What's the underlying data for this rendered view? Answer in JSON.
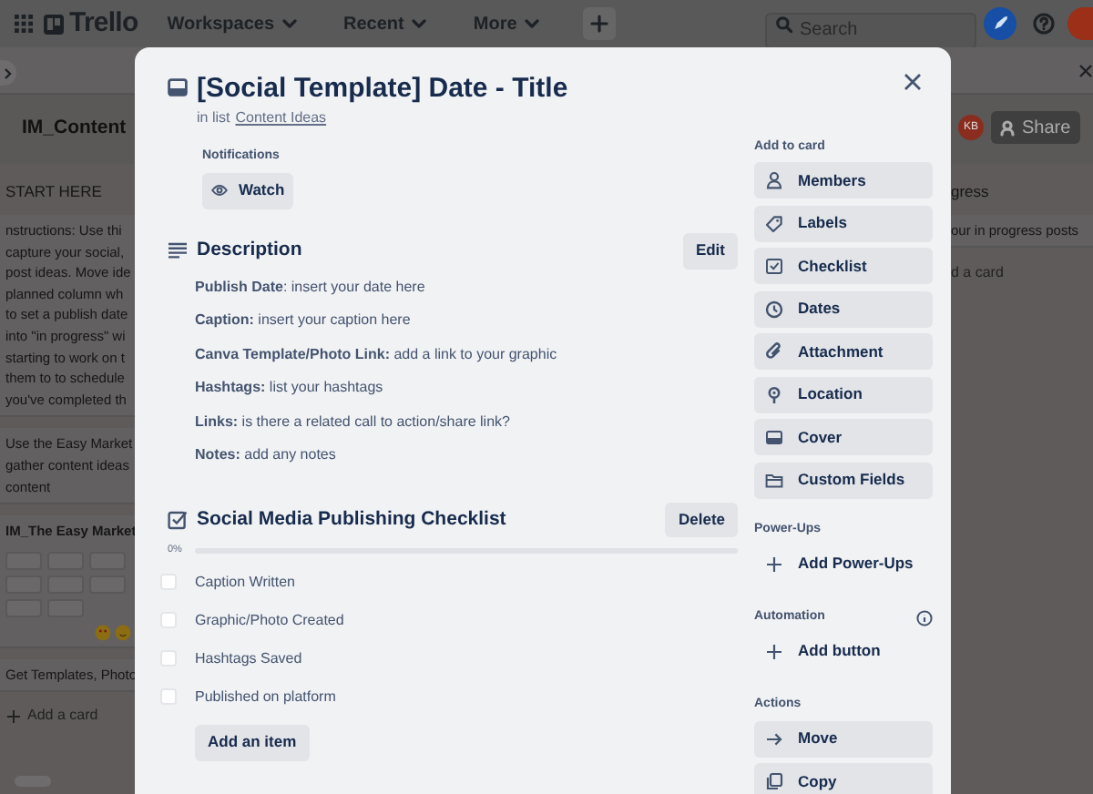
{
  "top_nav": {
    "logo": "Trello",
    "menus": [
      {
        "label": "Workspaces"
      },
      {
        "label": "Recent"
      },
      {
        "label": "More"
      }
    ],
    "search": {
      "placeholder": "Search"
    }
  },
  "board": {
    "title": "IM_Content",
    "avatar": "KB",
    "share": "Share",
    "left_list": {
      "title": "START HERE",
      "cards": [
        {
          "kind": "text",
          "lines": [
            "nstructions: Use thi",
            "capture your social,",
            "post ideas. Move ide",
            "planned column wh",
            "to set a publish date",
            "into \"in progress\" wi",
            "starting to work on t",
            "them to to schedule",
            "you've completed th"
          ]
        },
        {
          "kind": "text",
          "lines": [
            "Use the Easy Market",
            "gather content ideas",
            "content"
          ]
        },
        {
          "kind": "tiles",
          "lines": [
            "IM_The Easy Market"
          ]
        },
        {
          "kind": "text",
          "lines": [
            "Get Templates, Photo"
          ]
        }
      ],
      "add_card": "Add a card"
    },
    "right_list": {
      "title": "gress",
      "cards": [
        {
          "lines": [
            "our in progress posts"
          ]
        }
      ],
      "add_card": "d a card"
    }
  },
  "card_modal": {
    "title": "[Social Template] Date - Title",
    "list_prefix": "in list",
    "list_link": "Content Ideas",
    "notifications": {
      "label": "Notifications",
      "button": "Watch"
    },
    "description": {
      "title": "Description",
      "edit": "Edit",
      "lines": [
        "**Publish Date**: insert your date here",
        "**Caption:** insert your caption here",
        "**Canva Template/Photo Link:** add a link to your graphic",
        "**Hashtags:** list your hashtags",
        "**Links:** is there a related call to action/share link?",
        "**Notes:** add any notes"
      ]
    },
    "checklist": {
      "title": "Social Media Publishing Checklist",
      "delete": "Delete",
      "percent": "0%",
      "level": 0,
      "items": [
        {
          "label": "Caption Written",
          "checked": false
        },
        {
          "label": "Graphic/Photo Created",
          "checked": false
        },
        {
          "label": "Hashtags Saved",
          "checked": false
        },
        {
          "label": "Published on platform",
          "checked": false
        }
      ],
      "add_item": "Add an item"
    },
    "sidebar": [
      {
        "title": "Add to card",
        "has_info": false,
        "buttons": [
          {
            "label": "Members",
            "kind": "menu"
          },
          {
            "label": "Labels",
            "kind": "menu"
          },
          {
            "label": "Checklist",
            "kind": "menu"
          },
          {
            "label": "Dates",
            "kind": "menu"
          },
          {
            "label": "Attachment",
            "kind": "menu"
          },
          {
            "label": "Location",
            "kind": "menu"
          },
          {
            "label": "Cover",
            "kind": "menu"
          },
          {
            "label": "Custom Fields",
            "kind": "menu"
          }
        ]
      },
      {
        "title": "Power-Ups",
        "has_info": false,
        "buttons": [
          {
            "label": "Add Power-Ups",
            "kind": "add"
          }
        ]
      },
      {
        "title": "Automation",
        "has_info": true,
        "buttons": [
          {
            "label": "Add button",
            "kind": "add"
          }
        ]
      },
      {
        "title": "Actions",
        "has_info": false,
        "buttons": [
          {
            "label": "Move",
            "kind": "menu"
          },
          {
            "label": "Copy",
            "kind": "menu"
          }
        ]
      }
    ]
  }
}
